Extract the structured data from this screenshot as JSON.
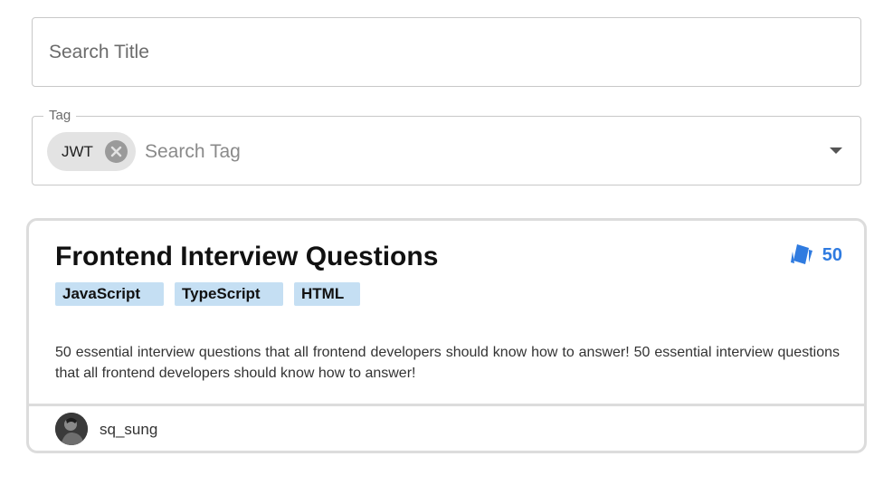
{
  "search": {
    "title_placeholder": "Search Title",
    "tag_label": "Tag",
    "tag_placeholder": "Search Tag",
    "selected_tags": [
      "JWT"
    ]
  },
  "card": {
    "title": "Frontend Interview Questions",
    "count": "50",
    "count_icon": "cards-icon",
    "tags": [
      "JavaScript",
      "TypeScript",
      "HTML"
    ],
    "description": "50 essential interview questions that all frontend developers should know how to answer! 50 essential interview questions that all frontend developers should know how to answer!",
    "author": "sq_sung"
  },
  "colors": {
    "accent": "#2f7be0",
    "tag_bg": "#c5dff3",
    "chip_bg": "#e3e3e3",
    "border": "#c8c8c8"
  }
}
